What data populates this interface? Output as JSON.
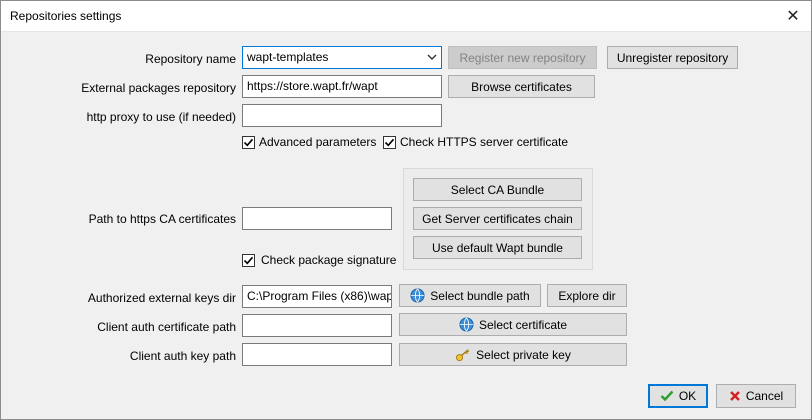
{
  "window": {
    "title": "Repositories settings",
    "close_symbol": "✕"
  },
  "form": {
    "repo_name_label": "Repository name",
    "repo_name_value": "wapt-templates",
    "register_button": "Register new repository",
    "unregister_button": "Unregister repository",
    "external_repo_label": "External packages repository",
    "external_repo_value": "https://store.wapt.fr/wapt",
    "browse_certificates_button": "Browse certificates",
    "proxy_label": "http proxy to use (if needed)",
    "proxy_value": "",
    "advanced_params_label": "Advanced parameters",
    "advanced_params_checked": true,
    "check_https_label": "Check HTTPS server certificate",
    "check_https_checked": true,
    "ca_path_label": "Path to https CA certificates",
    "ca_path_value": "",
    "select_ca_bundle_button": "Select CA Bundle",
    "get_server_chain_button": "Get Server certificates chain",
    "use_default_bundle_button": "Use default Wapt bundle",
    "check_signature_label": "Check package signature",
    "check_signature_checked": true,
    "authorized_keys_label": "Authorized external keys dir",
    "authorized_keys_value": "C:\\Program Files (x86)\\wap",
    "select_bundle_path_button": "Select bundle path",
    "explore_dir_button": "Explore dir",
    "client_cert_label": "Client auth certificate path",
    "client_cert_value": "",
    "select_certificate_button": "Select certificate",
    "client_key_label": "Client auth key path",
    "client_key_value": "",
    "select_private_key_button": "Select private key"
  },
  "footer": {
    "ok_button": "OK",
    "cancel_button": "Cancel"
  },
  "icons": {
    "globe": "globe-icon",
    "key": "key-icon",
    "checkmark": "checkmark-icon",
    "cross": "cross-icon"
  },
  "colors": {
    "accent": "#0078d7",
    "ok_green": "#2e9e2e",
    "cancel_red": "#d32020"
  }
}
